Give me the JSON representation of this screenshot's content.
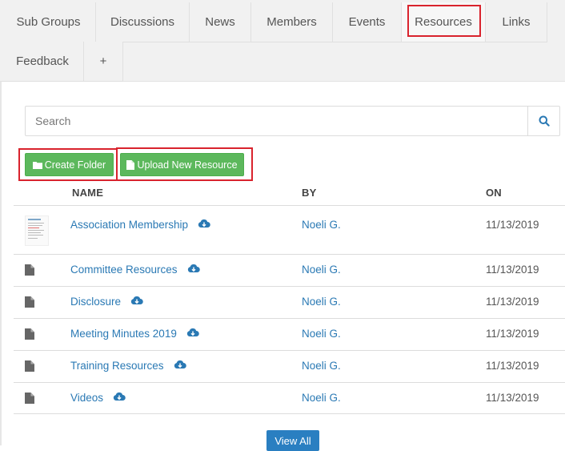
{
  "tabs": [
    {
      "label": "Sub Groups"
    },
    {
      "label": "Discussions"
    },
    {
      "label": "News"
    },
    {
      "label": "Members"
    },
    {
      "label": "Events"
    },
    {
      "label": "Resources"
    },
    {
      "label": "Links"
    },
    {
      "label": "Feedback"
    },
    {
      "label": "+"
    }
  ],
  "active_tab": "Resources",
  "search": {
    "placeholder": "Search",
    "value": ""
  },
  "actions": {
    "create_folder": "Create Folder",
    "upload": "Upload New Resource"
  },
  "table": {
    "headers": {
      "name": "NAME",
      "by": "BY",
      "on": "ON"
    },
    "rows": [
      {
        "name": "Association Membership",
        "by": "Noeli G.",
        "on": "11/13/2019",
        "icon": "document-thumbnail"
      },
      {
        "name": "Committee Resources",
        "by": "Noeli G.",
        "on": "11/13/2019",
        "icon": "file-icon"
      },
      {
        "name": "Disclosure",
        "by": "Noeli G.",
        "on": "11/13/2019",
        "icon": "file-icon"
      },
      {
        "name": "Meeting Minutes 2019",
        "by": "Noeli G.",
        "on": "11/13/2019",
        "icon": "file-icon"
      },
      {
        "name": "Training Resources",
        "by": "Noeli G.",
        "on": "11/13/2019",
        "icon": "file-icon"
      },
      {
        "name": "Videos",
        "by": "Noeli G.",
        "on": "11/13/2019",
        "icon": "file-icon"
      }
    ]
  },
  "view_all": "View All",
  "colors": {
    "link": "#2a79b4",
    "green": "#5cb85c",
    "highlight": "#d9232d",
    "primary": "#2a7fc1"
  }
}
